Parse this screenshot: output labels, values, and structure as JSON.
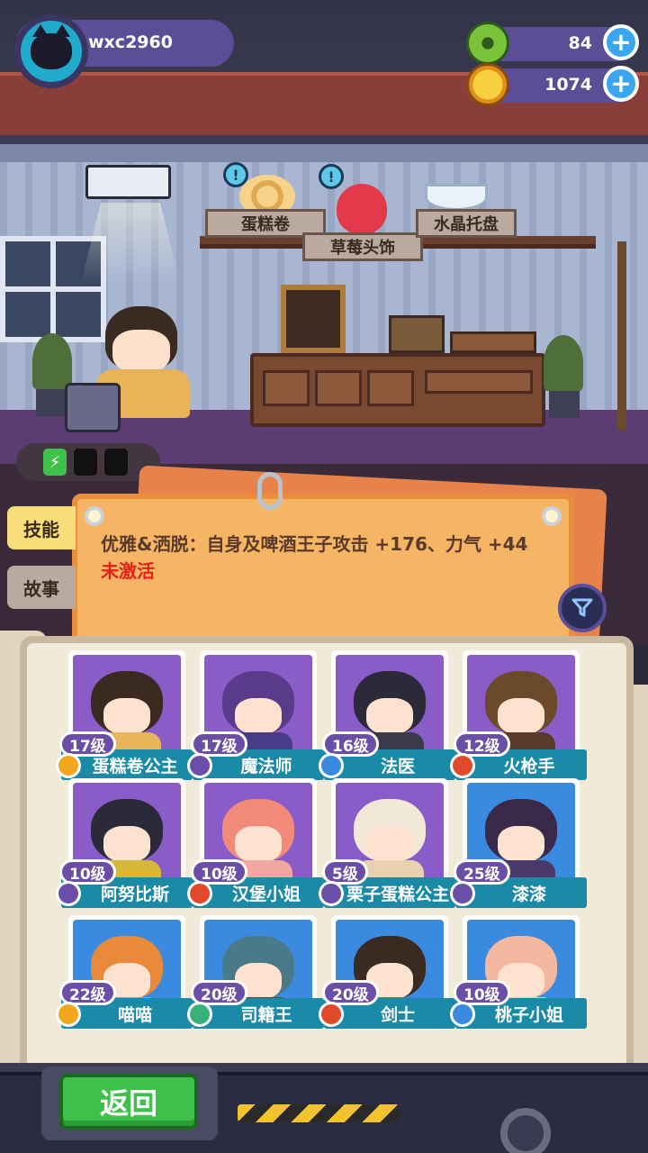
{
  "player": {
    "name": "wxc2960",
    "avatar_icon": "black-cat-icon"
  },
  "resources": [
    {
      "icon": "green-donut-icon",
      "value": "84",
      "color": "#7ac23a"
    },
    {
      "icon": "golden-planet-coin-icon",
      "value": "1074",
      "color": "#f2a81e"
    }
  ],
  "decorations": {
    "items": [
      {
        "label": "蛋糕卷",
        "icon": "cake-roll-icon"
      },
      {
        "label": "草莓头饰",
        "icon": "strawberry-icon"
      },
      {
        "label": "水晶托盘",
        "icon": "crystal-tray-icon"
      }
    ]
  },
  "energy": {
    "icon": "battery-charge-icon",
    "filled": 1,
    "total": 3
  },
  "tabs": {
    "skill": "技能",
    "story": "故事"
  },
  "skill": {
    "description": "优雅&洒脱：自身及啤酒王子攻击 +176、力气 +44",
    "status": "未激活",
    "status_color": "#e5201a"
  },
  "filter_icon": "filter-funnel-icon",
  "characters": [
    {
      "level": "17级",
      "name": "蛋糕卷公主",
      "bg": "#8a5cc8",
      "hair": "#3b2a22",
      "body": "#e8b45a",
      "rarity": "#f2a81e"
    },
    {
      "level": "17级",
      "name": "魔法师",
      "bg": "#8a5cc8",
      "hair": "#5a3a8a",
      "body": "#4a3a8a",
      "rarity": "#6a4ea8"
    },
    {
      "level": "16级",
      "name": "法医",
      "bg": "#8a5cc8",
      "hair": "#2a2a3a",
      "body": "#3a3a4a",
      "rarity": "#3a8ae0"
    },
    {
      "level": "12级",
      "name": "火枪手",
      "bg": "#8a5cc8",
      "hair": "#6a4a2a",
      "body": "#5a3a2a",
      "rarity": "#e04a2a"
    },
    {
      "level": "10级",
      "name": "阿努比斯",
      "bg": "#8a5cc8",
      "hair": "#2a2a3a",
      "body": "#d8b83a",
      "rarity": "#6a4ea8"
    },
    {
      "level": "10级",
      "name": "汉堡小姐",
      "bg": "#8a5cc8",
      "hair": "#f28a7a",
      "body": "#f2a8a0",
      "rarity": "#e04a2a"
    },
    {
      "level": "5级",
      "name": "栗子蛋糕公主",
      "bg": "#8a5cc8",
      "hair": "#f2e8d8",
      "body": "#e8d0b0",
      "rarity": "#6a4ea8"
    },
    {
      "level": "25级",
      "name": "漆漆",
      "bg": "#3a8ae0",
      "hair": "#3a2a4a",
      "body": "#4a3a6a",
      "rarity": "#6a4ea8"
    },
    {
      "level": "22级",
      "name": "喵喵",
      "bg": "#3a8ae0",
      "hair": "#e88a3a",
      "body": "#e88a3a",
      "rarity": "#f2a81e"
    },
    {
      "level": "20级",
      "name": "司籍王",
      "bg": "#3a8ae0",
      "hair": "#4a7a8a",
      "body": "#5a4a3a",
      "rarity": "#3ab07a"
    },
    {
      "level": "20级",
      "name": "剑士",
      "bg": "#3a8ae0",
      "hair": "#3a2a22",
      "body": "#4a8a3a",
      "rarity": "#e04a2a"
    },
    {
      "level": "10级",
      "name": "桃子小姐",
      "bg": "#3a8ae0",
      "hair": "#f2b8a0",
      "body": "#f2c8b8",
      "rarity": "#3a8ae0"
    }
  ],
  "back_button": "返回"
}
